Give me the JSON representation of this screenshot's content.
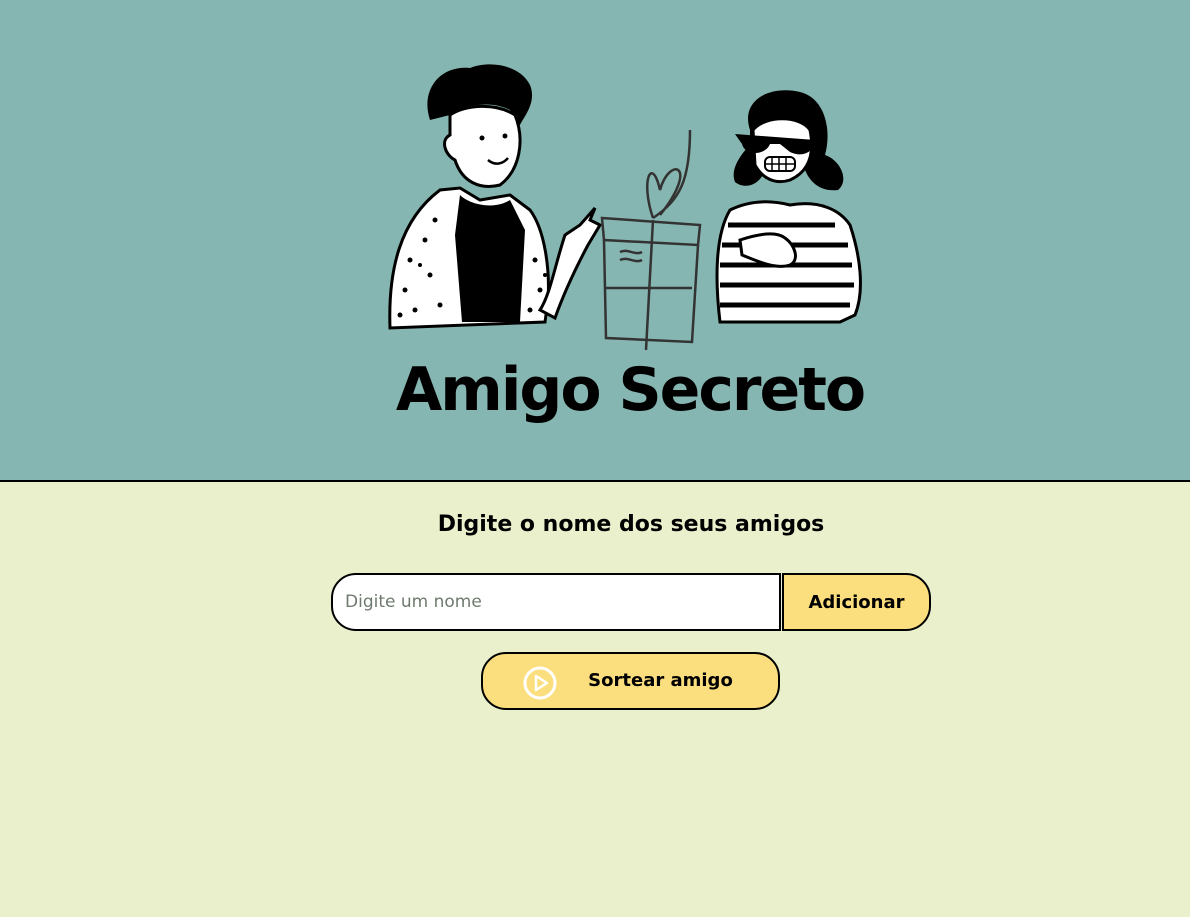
{
  "header": {
    "title": "Amigo Secreto",
    "background_color": "#86b6b1",
    "illustration": {
      "left_person_icon": "person-pointing-icon",
      "gift_icon": "gift-box-icon",
      "right_person_icon": "person-sunglasses-icon"
    }
  },
  "main": {
    "background_color": "#eaf0cc",
    "subtitle": "Digite o nome dos seus amigos",
    "input": {
      "placeholder": "Digite um nome",
      "value": ""
    },
    "add_button_label": "Adicionar",
    "draw_button": {
      "label": "Sortear amigo",
      "icon": "play-circle-icon"
    },
    "button_color": "#fbdf7e"
  }
}
